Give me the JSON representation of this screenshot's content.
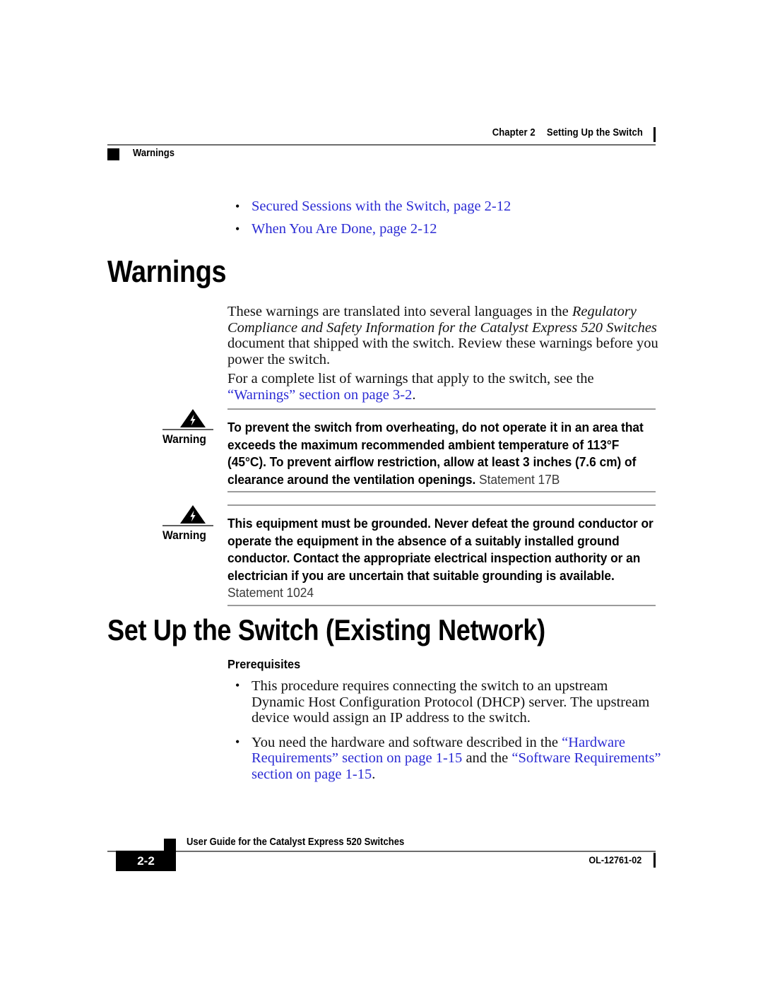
{
  "header": {
    "chapter_label": "Chapter 2",
    "chapter_title": "Setting Up the Switch",
    "section_label": "Warnings"
  },
  "crossref_list": [
    {
      "text": "Secured Sessions with the Switch, page 2-12"
    },
    {
      "text": "When You Are Done, page 2-12"
    }
  ],
  "headings": {
    "warnings": "Warnings",
    "setup": "Set Up the Switch (Existing Network)"
  },
  "paragraphs": {
    "intro_part1": "These warnings are translated into several languages in the ",
    "intro_italic": "Regulatory Compliance and Safety Information for the Catalyst Express 520 Switches",
    "intro_part2": " document that shipped with the switch. Review these warnings before you power the switch.",
    "complete_list_part1": "For a complete list of warnings that apply to the switch, see the ",
    "complete_list_link": "“Warnings” section on page 3-2",
    "complete_list_part2": "."
  },
  "warnings": [
    {
      "label": "Warning",
      "icon": "warning-lightning-triangle-icon",
      "body": "To prevent the switch from overheating, do not operate it in an area that exceeds the maximum recommended ambient temperature of 113°F (45°C). To prevent airflow restriction, allow at least 3 inches (7.6 cm) of clearance around the ventilation openings.",
      "statement": "Statement 17B"
    },
    {
      "label": "Warning",
      "icon": "warning-lightning-triangle-icon",
      "body": "This equipment must be grounded. Never defeat the ground conductor or operate the equipment in the absence of a suitably installed ground conductor. Contact the appropriate electrical inspection authority or an electrician if you are uncertain that suitable grounding is available.",
      "statement": "Statement 1024"
    }
  ],
  "prerequisites": {
    "title": "Prerequisites",
    "items": [
      {
        "text": "This procedure requires connecting the switch to an upstream Dynamic Host Configuration Protocol (DHCP) server. The upstream device would assign an IP address to the switch."
      },
      {
        "pre": "You need the hardware and software described in the ",
        "link1": "“Hardware Requirements” section on page 1-15",
        "mid": " and the ",
        "link2": "“Software Requirements” section on page 1-15",
        "post": "."
      }
    ]
  },
  "footer": {
    "page_number": "2-2",
    "document_title": "User Guide for the Catalyst Express 520 Switches",
    "doc_id": "OL-12761-02"
  },
  "colors": {
    "link": "#2b2bd4",
    "rule": "#6d6d6d",
    "warn_rule": "#9b9b9b",
    "text": "#000000"
  }
}
